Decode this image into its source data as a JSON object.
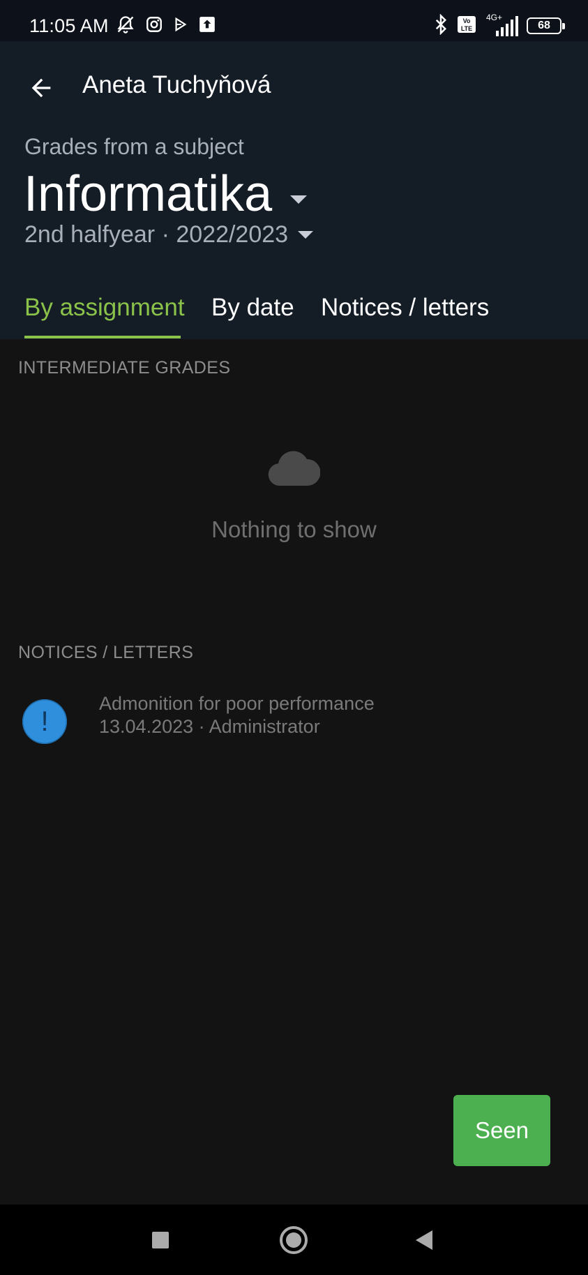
{
  "status_bar": {
    "time": "11:05 AM",
    "battery": "68",
    "network": "4G+",
    "icons_left": [
      "bell-off-icon",
      "instagram-icon",
      "play-store-icon",
      "upload-icon"
    ],
    "icons_right": [
      "bluetooth-icon",
      "volte-icon",
      "signal-icon",
      "battery-icon"
    ]
  },
  "header": {
    "student_name": "Aneta Tuchyňová",
    "subtitle": "Grades from a subject",
    "subject": "Informatika",
    "period": "2nd halfyear · 2022/2023"
  },
  "tabs": [
    {
      "label": "By assignment",
      "active": true
    },
    {
      "label": "By date",
      "active": false
    },
    {
      "label": "Notices / letters",
      "active": false
    }
  ],
  "sections": {
    "intermediate_grades": {
      "label": "INTERMEDIATE GRADES",
      "empty_text": "Nothing to show"
    },
    "notices": {
      "label": "NOTICES / LETTERS",
      "items": [
        {
          "title": "Admonition for poor performance",
          "meta": "13.04.2023 · Administrator",
          "icon_text": "!"
        }
      ]
    }
  },
  "actions": {
    "seen_label": "Seen"
  },
  "colors": {
    "accent_green": "#8bc34a",
    "button_green": "#4caf50",
    "notice_blue": "#2f8fdd",
    "header_bg": "#141c26",
    "body_bg": "#131313"
  }
}
